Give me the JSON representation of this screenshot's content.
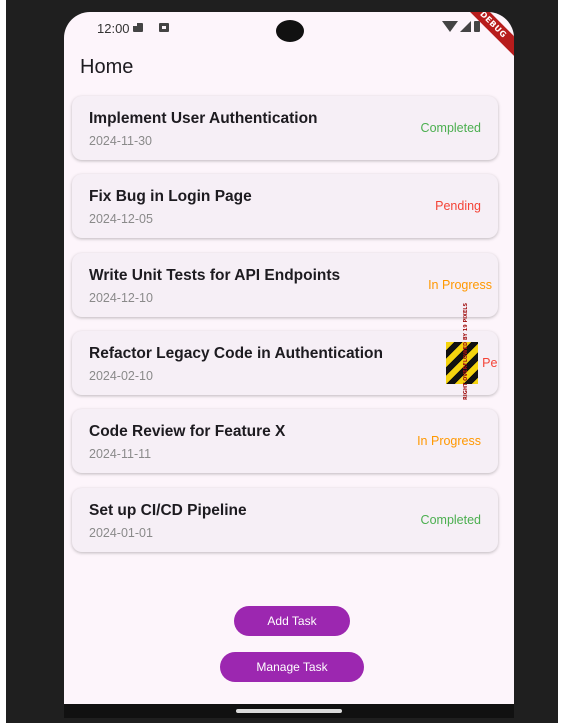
{
  "status_bar": {
    "time": "12:00",
    "debug_banner": "DEBUG"
  },
  "app": {
    "title": "Home"
  },
  "tasks": [
    {
      "title": "Implement User Authentication",
      "date": "2024-11-30",
      "status": "Completed",
      "status_color": "#4caf50"
    },
    {
      "title": "Fix Bug in Login Page",
      "date": "2024-12-05",
      "status": "Pending",
      "status_color": "#f44336"
    },
    {
      "title": "Write Unit Tests for API Endpoints",
      "date": "2024-12-10",
      "status": "In Progress",
      "status_color": "#ff9800"
    },
    {
      "title": "Refactor Legacy Code in Authentication",
      "date": "2024-02-10",
      "status": "Pending",
      "status_color": "#f44336"
    },
    {
      "title": "Code Review for Feature X",
      "date": "2024-11-11",
      "status": "In Progress",
      "status_color": "#ff9800"
    },
    {
      "title": "Set up CI/CD Pipeline",
      "date": "2024-01-01",
      "status": "Completed",
      "status_color": "#4caf50"
    }
  ],
  "overflow_warning": "RIGHT OVERFLOWED BY 19 PIXELS",
  "buttons": {
    "add_task": "Add Task",
    "manage_task": "Manage Task"
  },
  "colors": {
    "accent": "#9c27b0",
    "background": "#fdf5fb",
    "card": "#f6eff6"
  }
}
